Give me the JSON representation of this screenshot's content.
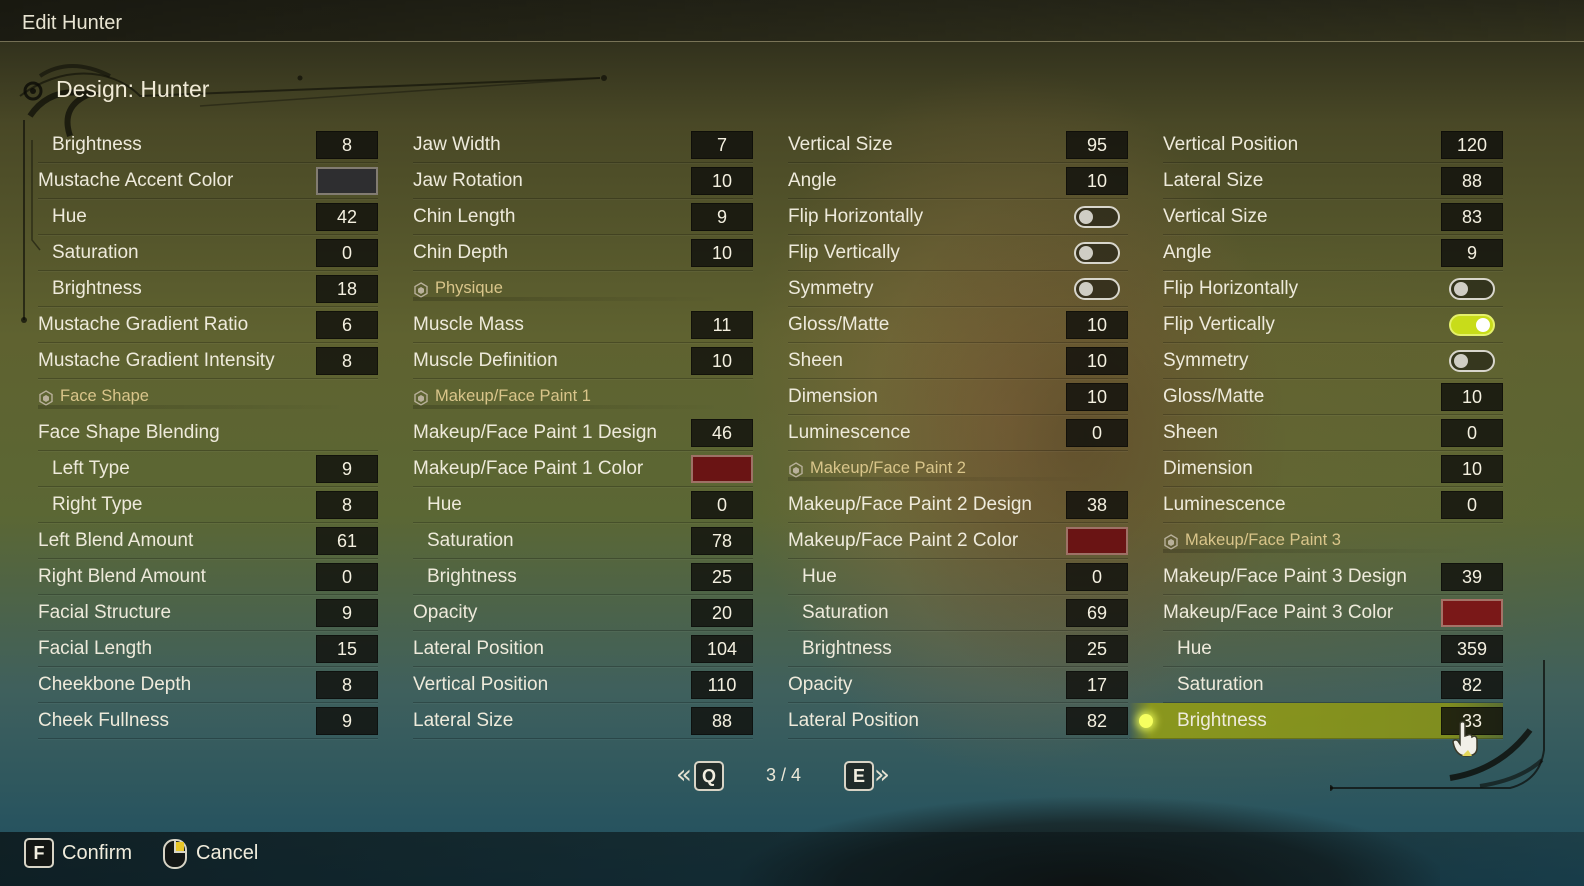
{
  "window_title": "Edit Hunter",
  "design_title": "Design: Hunter",
  "columns": [
    [
      {
        "label": "Brightness",
        "value": "8",
        "kind": "value",
        "indent": true
      },
      {
        "label": "Mustache Accent Color",
        "kind": "swatch",
        "color": "#2e2e30"
      },
      {
        "label": "Hue",
        "value": "42",
        "kind": "value",
        "indent": true
      },
      {
        "label": "Saturation",
        "value": "0",
        "kind": "value",
        "indent": true
      },
      {
        "label": "Brightness",
        "value": "18",
        "kind": "value",
        "indent": true
      },
      {
        "label": "Mustache Gradient Ratio",
        "value": "6",
        "kind": "value"
      },
      {
        "label": "Mustache Gradient Intensity",
        "value": "8",
        "kind": "value"
      },
      {
        "label": "Face Shape",
        "kind": "header"
      },
      {
        "label": "Face Shape Blending",
        "kind": "label"
      },
      {
        "label": "Left Type",
        "value": "9",
        "kind": "value",
        "indent": true
      },
      {
        "label": "Right Type",
        "value": "8",
        "kind": "value",
        "indent": true
      },
      {
        "label": "Left Blend Amount",
        "value": "61",
        "kind": "value"
      },
      {
        "label": "Right Blend Amount",
        "value": "0",
        "kind": "value"
      },
      {
        "label": "Facial Structure",
        "value": "9",
        "kind": "value"
      },
      {
        "label": "Facial Length",
        "value": "15",
        "kind": "value"
      },
      {
        "label": "Cheekbone Depth",
        "value": "8",
        "kind": "value"
      },
      {
        "label": "Cheek Fullness",
        "value": "9",
        "kind": "value"
      }
    ],
    [
      {
        "label": "Jaw Width",
        "value": "7",
        "kind": "value"
      },
      {
        "label": "Jaw Rotation",
        "value": "10",
        "kind": "value"
      },
      {
        "label": "Chin Length",
        "value": "9",
        "kind": "value"
      },
      {
        "label": "Chin Depth",
        "value": "10",
        "kind": "value"
      },
      {
        "label": "Physique",
        "kind": "header"
      },
      {
        "label": "Muscle Mass",
        "value": "11",
        "kind": "value"
      },
      {
        "label": "Muscle Definition",
        "value": "10",
        "kind": "value"
      },
      {
        "label": "Makeup/Face Paint 1",
        "kind": "header"
      },
      {
        "label": "Makeup/Face Paint 1 Design",
        "value": "46",
        "kind": "value"
      },
      {
        "label": "Makeup/Face Paint 1 Color",
        "kind": "swatch",
        "color": "#6a1414"
      },
      {
        "label": "Hue",
        "value": "0",
        "kind": "value",
        "indent": true
      },
      {
        "label": "Saturation",
        "value": "78",
        "kind": "value",
        "indent": true
      },
      {
        "label": "Brightness",
        "value": "25",
        "kind": "value",
        "indent": true
      },
      {
        "label": "Opacity",
        "value": "20",
        "kind": "value"
      },
      {
        "label": "Lateral Position",
        "value": "104",
        "kind": "value"
      },
      {
        "label": "Vertical Position",
        "value": "110",
        "kind": "value"
      },
      {
        "label": "Lateral Size",
        "value": "88",
        "kind": "value"
      }
    ],
    [
      {
        "label": "Vertical Size",
        "value": "95",
        "kind": "value"
      },
      {
        "label": "Angle",
        "value": "10",
        "kind": "value"
      },
      {
        "label": "Flip Horizontally",
        "kind": "toggle",
        "on": false
      },
      {
        "label": "Flip Vertically",
        "kind": "toggle",
        "on": false
      },
      {
        "label": "Symmetry",
        "kind": "toggle",
        "on": false
      },
      {
        "label": "Gloss/Matte",
        "value": "10",
        "kind": "value"
      },
      {
        "label": "Sheen",
        "value": "10",
        "kind": "value"
      },
      {
        "label": "Dimension",
        "value": "10",
        "kind": "value"
      },
      {
        "label": "Luminescence",
        "value": "0",
        "kind": "value"
      },
      {
        "label": "Makeup/Face Paint 2",
        "kind": "header"
      },
      {
        "label": "Makeup/Face Paint 2 Design",
        "value": "38",
        "kind": "value"
      },
      {
        "label": "Makeup/Face Paint 2 Color",
        "kind": "swatch",
        "color": "#6a1414"
      },
      {
        "label": "Hue",
        "value": "0",
        "kind": "value",
        "indent": true
      },
      {
        "label": "Saturation",
        "value": "69",
        "kind": "value",
        "indent": true
      },
      {
        "label": "Brightness",
        "value": "25",
        "kind": "value",
        "indent": true
      },
      {
        "label": "Opacity",
        "value": "17",
        "kind": "value"
      },
      {
        "label": "Lateral Position",
        "value": "82",
        "kind": "value"
      }
    ],
    [
      {
        "label": "Vertical Position",
        "value": "120",
        "kind": "value"
      },
      {
        "label": "Lateral Size",
        "value": "88",
        "kind": "value"
      },
      {
        "label": "Vertical Size",
        "value": "83",
        "kind": "value"
      },
      {
        "label": "Angle",
        "value": "9",
        "kind": "value"
      },
      {
        "label": "Flip Horizontally",
        "kind": "toggle",
        "on": false
      },
      {
        "label": "Flip Vertically",
        "kind": "toggle",
        "on": true
      },
      {
        "label": "Symmetry",
        "kind": "toggle",
        "on": false
      },
      {
        "label": "Gloss/Matte",
        "value": "10",
        "kind": "value"
      },
      {
        "label": "Sheen",
        "value": "0",
        "kind": "value"
      },
      {
        "label": "Dimension",
        "value": "10",
        "kind": "value"
      },
      {
        "label": "Luminescence",
        "value": "0",
        "kind": "value"
      },
      {
        "label": "Makeup/Face Paint 3",
        "kind": "header"
      },
      {
        "label": "Makeup/Face Paint 3 Design",
        "value": "39",
        "kind": "value"
      },
      {
        "label": "Makeup/Face Paint 3 Color",
        "kind": "swatch",
        "color": "#7a1818"
      },
      {
        "label": "Hue",
        "value": "359",
        "kind": "value",
        "indent": true
      },
      {
        "label": "Saturation",
        "value": "82",
        "kind": "value",
        "indent": true
      },
      {
        "label": "Brightness",
        "value": "33",
        "kind": "value",
        "indent": true,
        "selected": true
      }
    ]
  ],
  "pager": {
    "prev_key": "Q",
    "next_key": "E",
    "page": "3 / 4",
    "prev_icon": "double-chevron-left",
    "next_icon": "double-chevron-right"
  },
  "footer": {
    "confirm_key": "F",
    "confirm_label": "Confirm",
    "cancel_icon": "mouse-right-button",
    "cancel_label": "Cancel"
  },
  "colors": {
    "accent": "#c8dc1a",
    "header_text": "#d9c58a"
  }
}
